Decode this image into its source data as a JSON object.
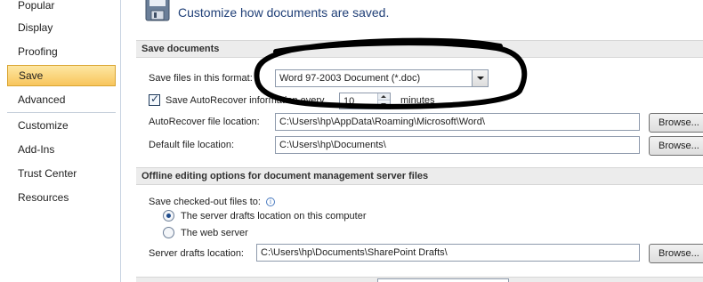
{
  "sidebar": {
    "items": [
      {
        "label": "Popular",
        "selected": false
      },
      {
        "label": "Display",
        "selected": false
      },
      {
        "label": "Proofing",
        "selected": false
      },
      {
        "label": "Save",
        "selected": true
      },
      {
        "label": "Advanced",
        "selected": false
      },
      {
        "label": "Customize",
        "selected": false
      },
      {
        "label": "Add-Ins",
        "selected": false
      },
      {
        "label": "Trust Center",
        "selected": false
      },
      {
        "label": "Resources",
        "selected": false
      }
    ]
  },
  "header": {
    "icon": "floppy-disk-icon",
    "text": "Customize how documents are saved."
  },
  "save_documents": {
    "title": "Save documents",
    "format_label": "Save files in this format:",
    "format_value": "Word 97-2003 Document (*.doc)",
    "autorecover_checked": true,
    "autorecover_label": "Save AutoRecover information every",
    "autorecover_minutes": "10",
    "minutes_label": "minutes",
    "autorecover_location_label": "AutoRecover file location:",
    "autorecover_location_value": "C:\\Users\\hp\\AppData\\Roaming\\Microsoft\\Word\\",
    "default_location_label": "Default file location:",
    "default_location_value": "C:\\Users\\hp\\Documents\\",
    "browse_label": "Browse..."
  },
  "offline_editing": {
    "title": "Offline editing options for document management server files",
    "checked_out_label": "Save checked-out files to:",
    "info_icon": "info-icon",
    "radio_options": [
      {
        "label": "The server drafts location on this computer",
        "checked": true
      },
      {
        "label": "The web server",
        "checked": false
      }
    ],
    "drafts_location_label": "Server drafts location:",
    "drafts_location_value": "C:\\Users\\hp\\Documents\\SharePoint Drafts\\",
    "browse_label": "Browse..."
  },
  "colors": {
    "selected_nav": "#f8c55c",
    "header_text": "#1f3f77",
    "section_bg": "#ececec",
    "annotation": "#000000"
  }
}
